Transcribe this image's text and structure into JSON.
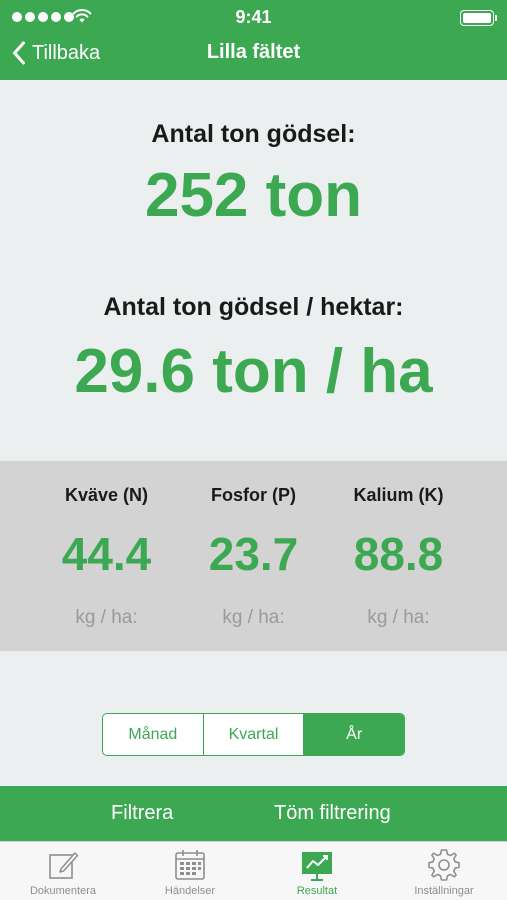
{
  "status_bar": {
    "time": "9:41"
  },
  "nav": {
    "back_label": "Tillbaka",
    "title": "Lilla fältet"
  },
  "total": {
    "label": "Antal ton gödsel:",
    "value": "252 ton"
  },
  "per_hectare": {
    "label": "Antal ton gödsel / hektar:",
    "value": "29.6 ton / ha"
  },
  "nutrients": [
    {
      "label": "Kväve (N)",
      "value": "44.4",
      "unit": "kg / ha:"
    },
    {
      "label": "Fosfor (P)",
      "value": "23.7",
      "unit": "kg / ha:"
    },
    {
      "label": "Kalium (K)",
      "value": "88.8",
      "unit": "kg / ha:"
    }
  ],
  "period_selector": {
    "options": [
      "Månad",
      "Kvartal",
      "År"
    ],
    "selected": "År"
  },
  "filter_bar": {
    "filter_label": "Filtrera",
    "clear_label": "Töm filtrering"
  },
  "tab_bar": {
    "tabs": [
      {
        "label": "Dokumentera",
        "icon": "compose-icon"
      },
      {
        "label": "Händelser",
        "icon": "calendar-icon"
      },
      {
        "label": "Resultat",
        "icon": "chart-presentation-icon"
      },
      {
        "label": "Inställningar",
        "icon": "gear-icon"
      }
    ],
    "active": "Resultat"
  },
  "colors": {
    "accent": "#3da852",
    "background": "#eceff0",
    "panel": "#d3d3d3"
  }
}
